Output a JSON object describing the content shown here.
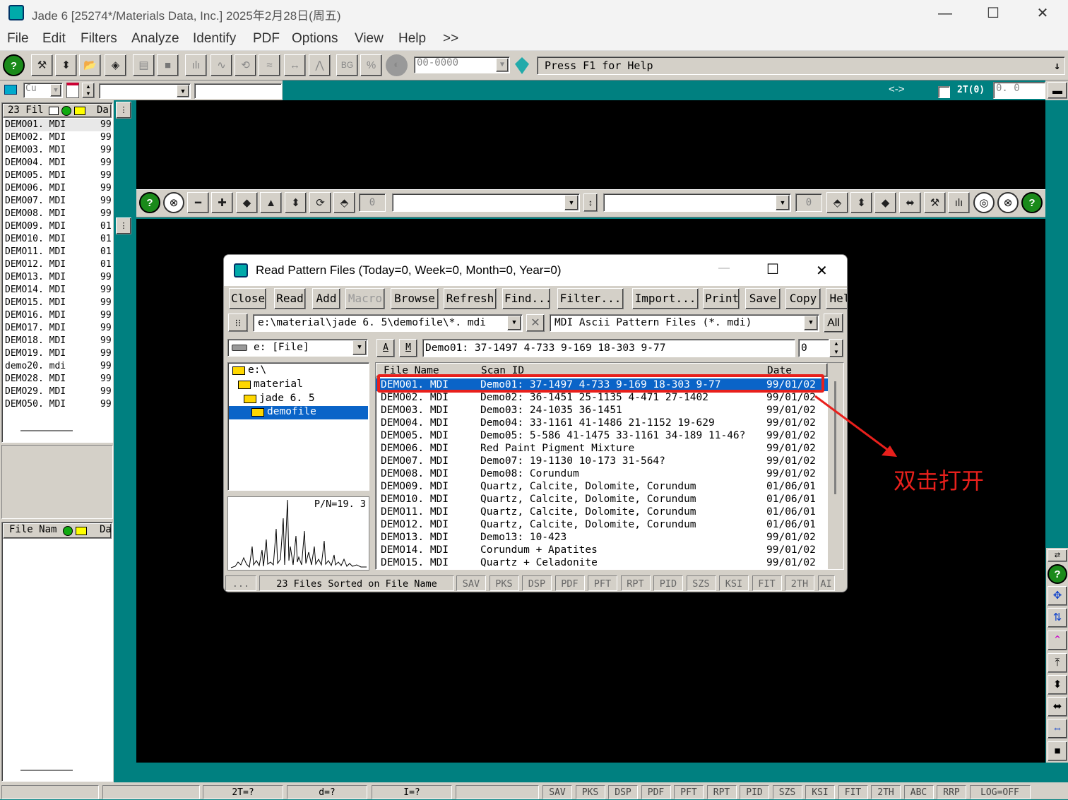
{
  "app": {
    "title": "Jade 6 [25274*/Materials Data, Inc.] 2025年2月28日(周五)",
    "minimize": "—",
    "maximize": "☐",
    "close": "✕"
  },
  "menu": [
    "File",
    "Edit",
    "Filters",
    "Analyze",
    "Identify",
    "PDF",
    "Options",
    "View",
    "Help",
    ">>"
  ],
  "toolbar": {
    "pdf_field": "00-0000",
    "help_text": "Press F1 for Help",
    "down_arrow": "↓"
  },
  "toolbar2": {
    "anode": "Cu",
    "arrows": "<->",
    "two_theta_label": "2T(0)",
    "two_theta_value": "0. 0"
  },
  "left_panel": {
    "header_count": "23 Fil",
    "header_date": "Da",
    "files": [
      {
        "name": "DEMO01. MDI",
        "d": "99"
      },
      {
        "name": "DEMO02. MDI",
        "d": "99"
      },
      {
        "name": "DEMO03. MDI",
        "d": "99"
      },
      {
        "name": "DEMO04. MDI",
        "d": "99"
      },
      {
        "name": "DEMO05. MDI",
        "d": "99"
      },
      {
        "name": "DEMO06. MDI",
        "d": "99"
      },
      {
        "name": "DEMO07. MDI",
        "d": "99"
      },
      {
        "name": "DEMO08. MDI",
        "d": "99"
      },
      {
        "name": "DEMO09. MDI",
        "d": "01"
      },
      {
        "name": "DEMO10. MDI",
        "d": "01"
      },
      {
        "name": "DEMO11. MDI",
        "d": "01"
      },
      {
        "name": "DEMO12. MDI",
        "d": "01"
      },
      {
        "name": "DEMO13. MDI",
        "d": "99"
      },
      {
        "name": "DEMO14. MDI",
        "d": "99"
      },
      {
        "name": "DEMO15. MDI",
        "d": "99"
      },
      {
        "name": "DEMO16. MDI",
        "d": "99"
      },
      {
        "name": "DEMO17. MDI",
        "d": "99"
      },
      {
        "name": "DEMO18. MDI",
        "d": "99"
      },
      {
        "name": "DEMO19. MDI",
        "d": "99"
      },
      {
        "name": "demo20. mdi",
        "d": "99"
      },
      {
        "name": "DEMO28. MDI",
        "d": "99"
      },
      {
        "name": "DEMO29. MDI",
        "d": "99"
      },
      {
        "name": "DEMO50. MDI",
        "d": "99"
      }
    ],
    "lower_header_name": "File Nam",
    "lower_header_date": "Da"
  },
  "plot_toolbar": {
    "left_value": "0",
    "right_value": "0"
  },
  "dialog": {
    "title": "Read Pattern Files (Today=0, Week=0, Month=0, Year=0)",
    "buttons": [
      "Close",
      "Read",
      "Add",
      "Macro",
      "Browse",
      "Refresh",
      "Find...",
      "Filter...",
      "Import...",
      "Print",
      "Save",
      "Copy",
      "Hel"
    ],
    "path": "e:\\material\\jade 6. 5\\demofile\\*. mdi",
    "filetype": "MDI Ascii Pattern Files (*. mdi)",
    "all_button": "All",
    "drive": "e: [File]",
    "a_btn": "A",
    "m_btn": "M",
    "scan_preview": "Demo01: 37-1497 4-733 9-169 18-303 9-77",
    "spin_value": "0",
    "tree": [
      "e:\\",
      "material",
      "jade 6. 5",
      "demofile"
    ],
    "pn_label": "P/N=19. 3",
    "columns": {
      "name": "File Name",
      "scan": "Scan ID",
      "date": "Date"
    },
    "rows": [
      {
        "name": "DEMO01. MDI",
        "scan": "Demo01: 37-1497 4-733 9-169 18-303 9-77",
        "date": "99/01/02"
      },
      {
        "name": "DEMO02. MDI",
        "scan": "Demo02: 36-1451 25-1135 4-471 27-1402",
        "date": "99/01/02"
      },
      {
        "name": "DEMO03. MDI",
        "scan": "Demo03: 24-1035 36-1451",
        "date": "99/01/02"
      },
      {
        "name": "DEMO04. MDI",
        "scan": "Demo04: 33-1161 41-1486 21-1152 19-629",
        "date": "99/01/02"
      },
      {
        "name": "DEMO05. MDI",
        "scan": "Demo05: 5-586 41-1475 33-1161 34-189 11-46?",
        "date": "99/01/02"
      },
      {
        "name": "DEMO06. MDI",
        "scan": "Red Paint Pigment Mixture",
        "date": "99/01/02"
      },
      {
        "name": "DEMO07. MDI",
        "scan": "Demo07: 19-1130 10-173 31-564?",
        "date": "99/01/02"
      },
      {
        "name": "DEMO08. MDI",
        "scan": "Demo08: Corundum",
        "date": "99/01/02"
      },
      {
        "name": "DEMO09. MDI",
        "scan": "Quartz, Calcite, Dolomite, Corundum",
        "date": "01/06/01"
      },
      {
        "name": "DEMO10. MDI",
        "scan": "Quartz, Calcite, Dolomite, Corundum",
        "date": "01/06/01"
      },
      {
        "name": "DEMO11. MDI",
        "scan": "Quartz, Calcite, Dolomite, Corundum",
        "date": "01/06/01"
      },
      {
        "name": "DEMO12. MDI",
        "scan": "Quartz, Calcite, Dolomite, Corundum",
        "date": "01/06/01"
      },
      {
        "name": "DEMO13. MDI",
        "scan": "Demo13: 10-423",
        "date": "99/01/02"
      },
      {
        "name": "DEMO14. MDI",
        "scan": "Corundum + Apatites",
        "date": "99/01/02"
      },
      {
        "name": "DEMO15. MDI",
        "scan": "Quartz + Celadonite",
        "date": "99/01/02"
      }
    ],
    "status_dots": "...",
    "status_text": "23 Files Sorted on File Name",
    "status_tabs": [
      "SAV",
      "PKS",
      "DSP",
      "PDF",
      "PFT",
      "RPT",
      "PID",
      "SZS",
      "KSI",
      "FIT",
      "2TH",
      "AI"
    ]
  },
  "annotation": {
    "text": "双击打开",
    "color": "#e8201c"
  },
  "statusbar": {
    "fields": [
      "2T=?",
      "d=?",
      "I=?"
    ],
    "tabs": [
      "SAV",
      "PKS",
      "DSP",
      "PDF",
      "PFT",
      "RPT",
      "PID",
      "SZS",
      "KSI",
      "FIT",
      "2TH",
      "ABC",
      "RRP",
      "LOG=OFF"
    ]
  },
  "colors": {
    "teal": "#008080",
    "selection": "#0a64c8",
    "face": "#d4d0c8",
    "highlight_box": "#e8201c"
  }
}
